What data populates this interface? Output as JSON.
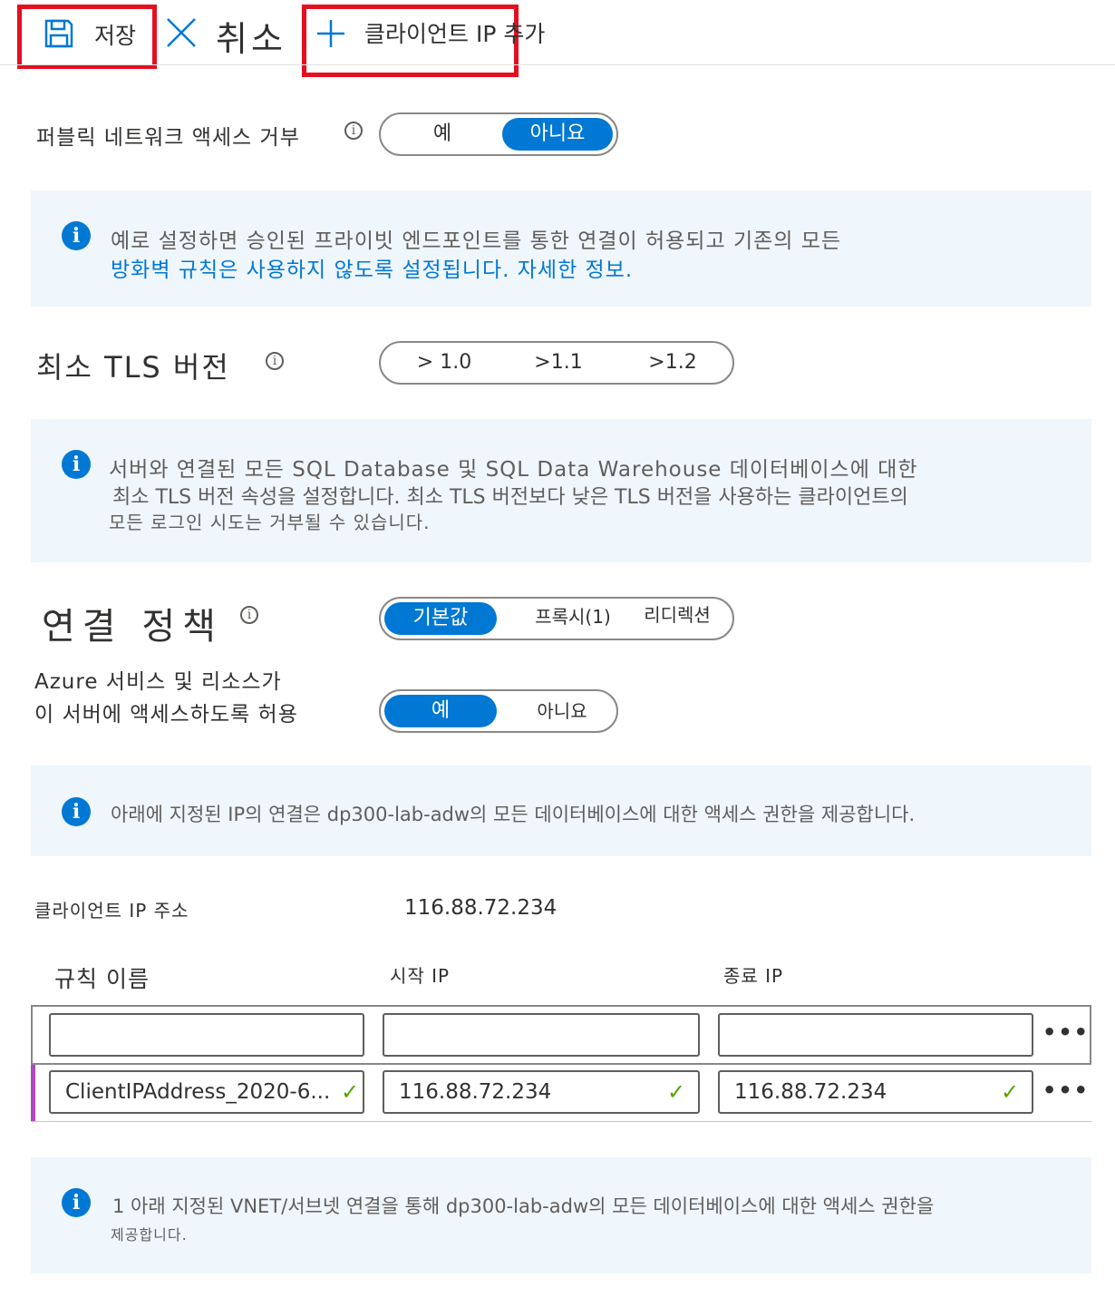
{
  "toolbar": {
    "save_label": "저장",
    "cancel_label": "취소",
    "add_client_ip_label": "클라이언트 IP 추가",
    "icons": {
      "save": "save-icon",
      "cancel": "close-icon",
      "add": "plus-icon"
    }
  },
  "public_access": {
    "label": "퍼블릭 네트워크 액세스 거부",
    "options": [
      "예",
      "아니요"
    ],
    "selected": "아니요"
  },
  "info_public": {
    "line1": "예로 설정하면 승인된 프라이빗 엔드포인트를 통한 연결이 허용되고 기존의 모든",
    "line2": "방화벽 규칙은 사용하지 않도록 설정됩니다. 자세한 정보."
  },
  "tls": {
    "label": "최소 TLS 버전",
    "options": [
      "> 1.0",
      ">1.1",
      ">1.2"
    ]
  },
  "info_tls": {
    "line1": "서버와 연결된 모든 SQL Database 및 SQL Data Warehouse 데이터베이스에 대한",
    "line2": "최소 TLS 버전 속성을 설정합니다. 최소 TLS 버전보다 낮은 TLS 버전을 사용하는 클라이언트의",
    "line3": "모든 로그인 시도는 거부될 수 있습니다."
  },
  "connection_policy": {
    "label": "연결 정책",
    "options": [
      "기본값",
      "프록시(1)",
      "리디렉션"
    ],
    "selected": "기본값"
  },
  "azure_services": {
    "label_line1": "Azure 서비스 및 리소스가",
    "label_line2": "이 서버에 액세스하도록 허용",
    "options": [
      "예",
      "아니요"
    ],
    "selected": "예"
  },
  "info_ip": {
    "text": "아래에 지정된 IP의 연결은 dp300-lab-adw의 모든 데이터베이스에 대한 액세스 권한을 제공합니다."
  },
  "client_ip": {
    "label": "클라이언트 IP 주소",
    "value": "116.88.72.234"
  },
  "rules_table": {
    "headers": [
      "규칙 이름",
      "시작 IP",
      "종료 IP"
    ],
    "rows": [
      {
        "name": "",
        "start_ip": "",
        "end_ip": ""
      },
      {
        "name": "ClientIPAddress_2020-6...",
        "start_ip": "116.88.72.234",
        "end_ip": "116.88.72.234"
      }
    ],
    "more_label": "•••",
    "check_glyph": "✓",
    "row_marker_color": "#b146c2"
  },
  "info_vnet": {
    "line1": "1 아래 지정된 VNET/서브넷 연결을 통해 dp300-lab-adw의 모든 데이터베이스에 대한 액세스 권한을",
    "line2": "제공합니다."
  },
  "colors": {
    "accent": "#0078d4",
    "highlight": "#e3101f",
    "info_background": "#eff6fc",
    "success": "#57a300"
  }
}
